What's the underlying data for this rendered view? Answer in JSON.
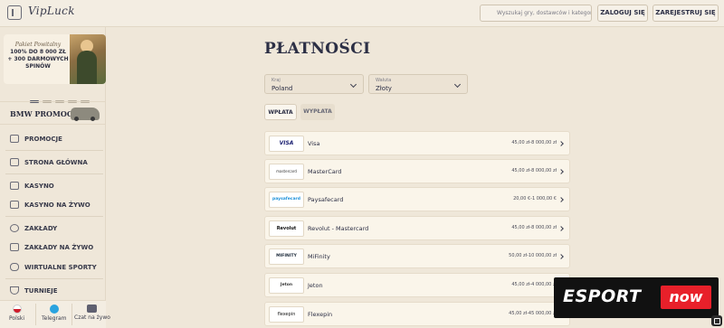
{
  "app": {
    "logo": "VipLuck"
  },
  "header": {
    "search_placeholder": "Wyszukaj gry, dostawców i kategorie",
    "login_label": "ZALOGUJ SIĘ",
    "register_label": "ZAREJESTRUJ SIĘ"
  },
  "sidebar": {
    "promo": {
      "line1": "Pakiet Powitalny",
      "line2": "100% DO 8 000 ZŁ + 300 DARMOWYCH SPINÓW"
    },
    "bmw_label": "BMW PROMOCJA",
    "items": [
      {
        "label": "PROMOCJE",
        "icon": "gift-icon"
      },
      {
        "label": "STRONA GŁÓWNA",
        "icon": "home-icon"
      },
      {
        "label": "KASYNO",
        "icon": "slot-icon"
      },
      {
        "label": "KASYNO NA ŻYWO",
        "icon": "live-casino-icon"
      },
      {
        "label": "ZAKŁADY",
        "icon": "ball-icon"
      },
      {
        "label": "ZAKŁADY NA ŻYWO",
        "icon": "live-bet-icon"
      },
      {
        "label": "WIRTUALNE SPORTY",
        "icon": "gamepad-icon"
      },
      {
        "label": "TURNIEJE",
        "icon": "trophy-icon"
      }
    ],
    "bottom": {
      "language": "Polski",
      "telegram": "Telegram",
      "chat": "Czat na żywo"
    }
  },
  "main": {
    "title": "PŁATNOŚCI",
    "country": {
      "caption": "Kraj",
      "value": "Poland"
    },
    "currency": {
      "caption": "Waluta",
      "value": "Złoty"
    },
    "tabs": [
      {
        "label": "WPŁATA",
        "active": true
      },
      {
        "label": "WYPŁATA",
        "active": false
      }
    ],
    "methods": [
      {
        "logo": "VISA",
        "name": "Visa",
        "range": "45,00 zł-8 000,00 zł"
      },
      {
        "logo": "mastercard",
        "name": "MasterCard",
        "range": "45,00 zł-8 000,00 zł"
      },
      {
        "logo": "paysafecard",
        "name": "Paysafecard",
        "range": "20,00 €-1 000,00 €"
      },
      {
        "logo": "Revolut",
        "name": "Revolut - Mastercard",
        "range": "45,00 zł-8 000,00 zł"
      },
      {
        "logo": "MIFINITY",
        "name": "MiFinity",
        "range": "50,00 zł-10 000,00 zł"
      },
      {
        "logo": "Jeton",
        "name": "Jeton",
        "range": "45,00 zł-4 000,00 zł"
      },
      {
        "logo": "flexepin",
        "name": "Flexepin",
        "range": "45,00 zł-45 000,00 zł"
      }
    ]
  },
  "watermark": {
    "text1": "ESPORT",
    "text2": "now"
  }
}
